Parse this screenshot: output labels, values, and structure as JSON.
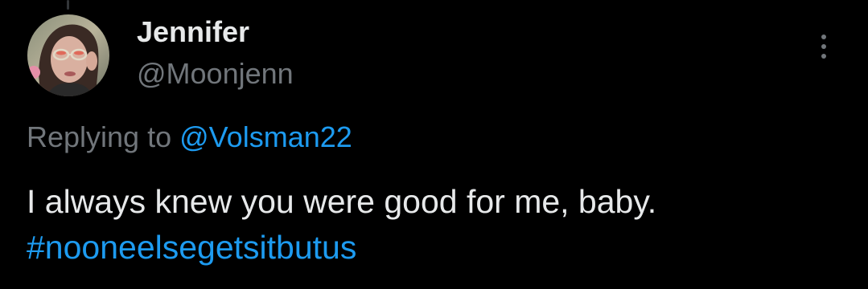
{
  "author": {
    "display_name": "Jennifer",
    "handle": "@Moonjenn"
  },
  "reply_context": {
    "prefix": "Replying to ",
    "mention": "@Volsman22"
  },
  "tweet": {
    "text": "I always knew you were good for me, baby.",
    "hashtag": "#nooneelsegetsitbutus"
  },
  "colors": {
    "background": "#000000",
    "primary_text": "#e7e9ea",
    "secondary_text": "#71767b",
    "link": "#1d9bf0"
  },
  "icons": {
    "more": "more-vertical-icon"
  }
}
